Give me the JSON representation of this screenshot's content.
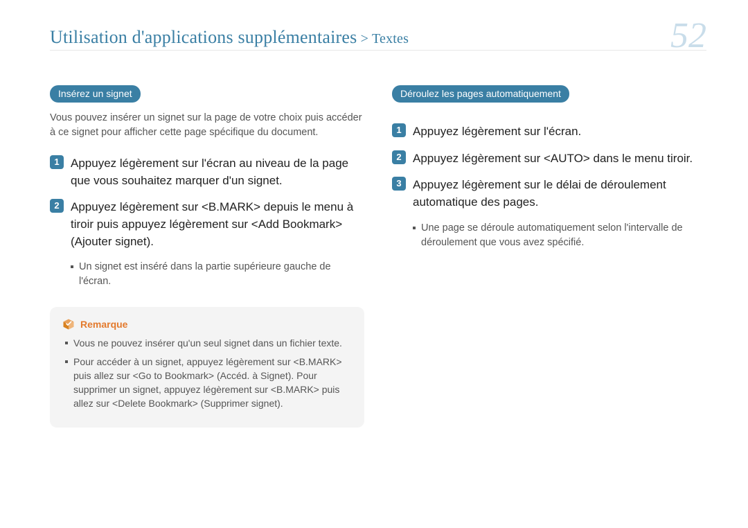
{
  "header": {
    "breadcrumb_main": "Utilisation d'applications supplémentaires",
    "breadcrumb_sep": " > ",
    "breadcrumb_sub": "Textes",
    "page_number": "52"
  },
  "left": {
    "pill": "Insérez un signet",
    "intro": "Vous pouvez insérer un signet sur la page de votre choix puis accéder à ce signet pour afficher cette page spécifique du document.",
    "steps": [
      {
        "num": "1",
        "text": "Appuyez légèrement sur l'écran au niveau de la page que vous souhaitez marquer d'un signet."
      },
      {
        "num": "2",
        "text": "Appuyez légèrement sur <B.MARK> depuis le menu à tiroir puis appuyez légèrement sur <Add Bookmark> (Ajouter signet).",
        "note": "Un signet est inséré dans la partie supérieure gauche de l'écran."
      }
    ],
    "remark": {
      "label": "Remarque",
      "items": [
        "Vous ne pouvez insérer qu'un seul signet dans un fichier texte.",
        "Pour accéder à un signet, appuyez légèrement sur <B.MARK> puis allez sur <Go to Bookmark> (Accéd. à Signet). Pour supprimer un signet, appuyez légèrement sur <B.MARK> puis allez sur <Delete Bookmark> (Supprimer signet)."
      ]
    }
  },
  "right": {
    "pill": "Déroulez les pages automatiquement",
    "steps": [
      {
        "num": "1",
        "text": "Appuyez légèrement sur l'écran."
      },
      {
        "num": "2",
        "text": "Appuyez légèrement sur <AUTO> dans le menu tiroir."
      },
      {
        "num": "3",
        "text": "Appuyez légèrement sur le délai de déroulement automatique des pages.",
        "note": "Une page se déroule automatiquement selon l'intervalle de déroulement que vous avez spécifié."
      }
    ]
  }
}
